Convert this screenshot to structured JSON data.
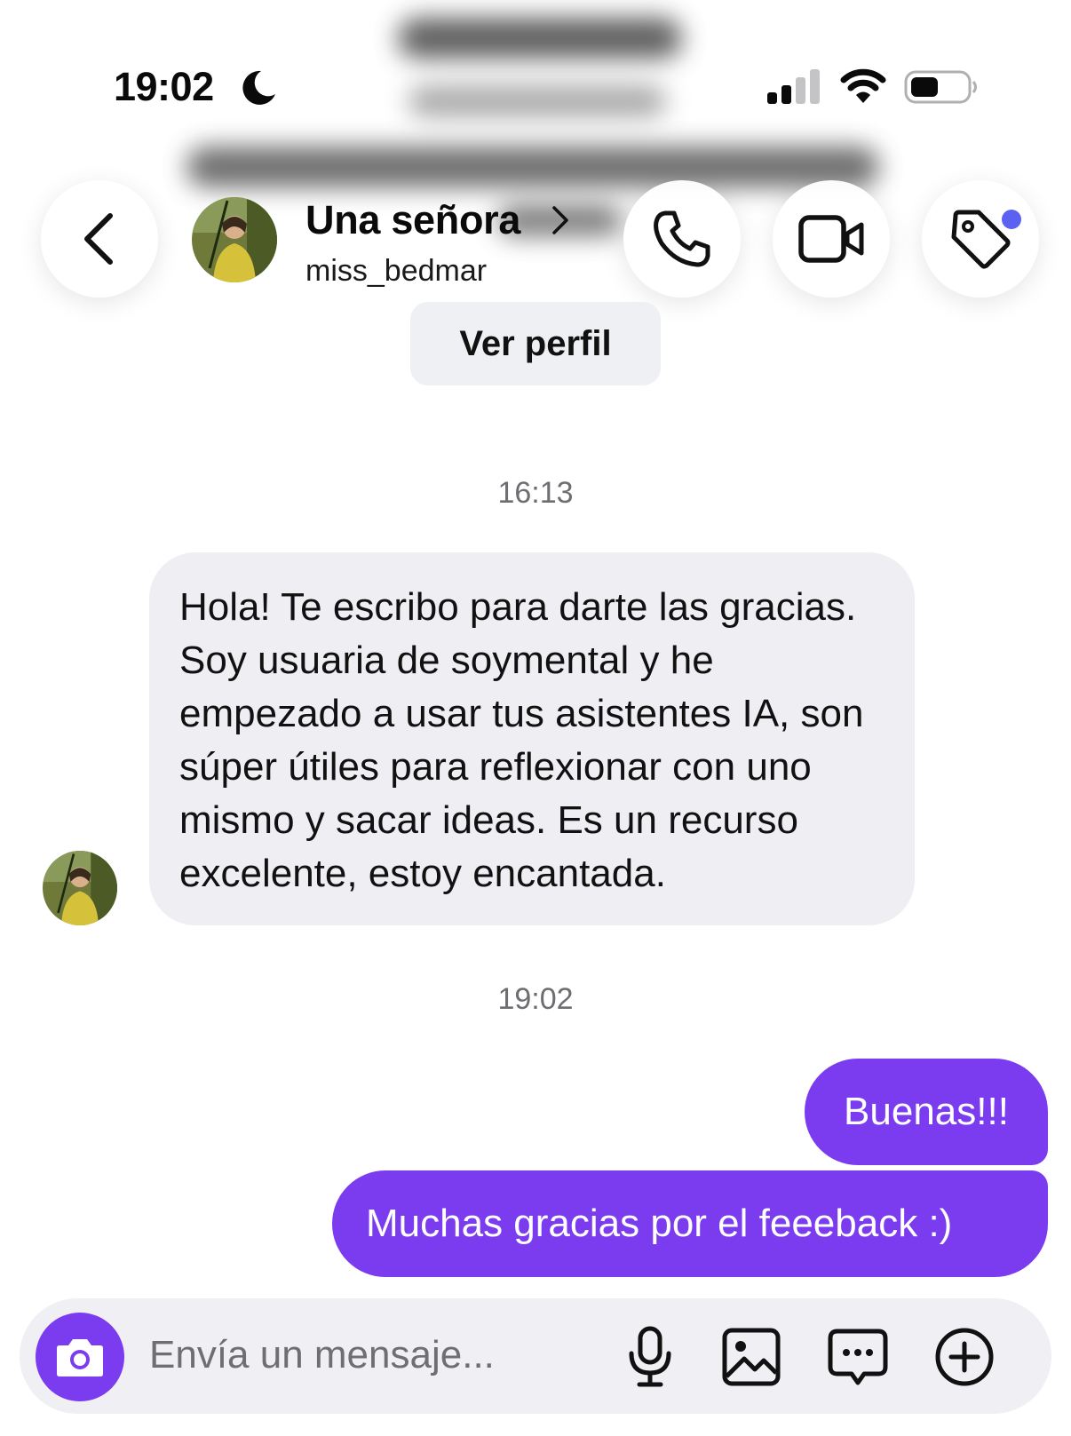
{
  "status_bar": {
    "time": "19:02"
  },
  "header": {
    "contact_name": "Una señora",
    "contact_handle": "miss_bedmar",
    "view_profile_label": "Ver perfil",
    "notification_dot_color": "#5b61f0"
  },
  "icons": [
    "moon-icon",
    "signal-icon",
    "wifi-icon",
    "battery-icon",
    "back-icon",
    "phone-icon",
    "video-camera-icon",
    "tag-icon",
    "camera-icon",
    "microphone-icon",
    "gallery-icon",
    "sticker-icon",
    "plus-icon"
  ],
  "messages": {
    "timestamp_1": "16:13",
    "incoming_text": "Hola! Te escribo para darte las gracias. Soy usuaria de soymental y he empezado a usar tus asistentes IA, son súper útiles para reflexionar con uno mismo y sacar ideas. Es un recurso excelente, estoy encantada.",
    "timestamp_2": "19:02",
    "outgoing": [
      {
        "text": "Buenas!!!"
      },
      {
        "text": "Muchas gracias por el feeeback :)"
      }
    ]
  },
  "composer": {
    "placeholder": "Envía un mensaje..."
  },
  "colors": {
    "outgoing_bubble": "#7b3cf0",
    "incoming_bubble": "#efeff3",
    "accent": "#7b3cf0"
  }
}
